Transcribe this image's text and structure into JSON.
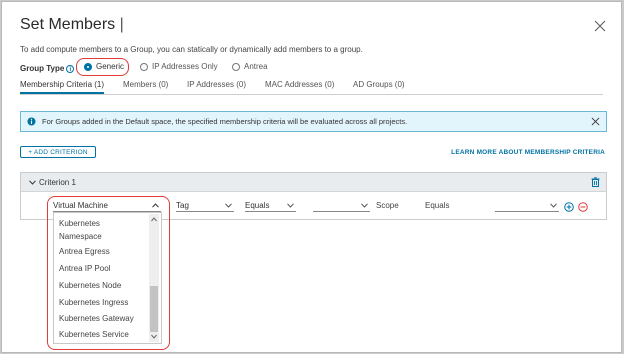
{
  "dialog": {
    "title": "Set Members",
    "title_cursor": "|",
    "description": "To add compute members to a Group, you can statically or dynamically add members to a group."
  },
  "group_type": {
    "label": "Group Type",
    "info_icon": "i",
    "options": [
      "Generic",
      "IP Addresses Only",
      "Antrea"
    ],
    "selected": "Generic"
  },
  "tabs": [
    {
      "label": "Membership Criteria (1)",
      "active": true
    },
    {
      "label": "Members (0)"
    },
    {
      "label": "IP Addresses (0)"
    },
    {
      "label": "MAC Addresses (0)"
    },
    {
      "label": "AD Groups (0)"
    }
  ],
  "alert": {
    "text": "For Groups added in the Default space, the specified membership criteria will be evaluated across all projects.",
    "icon": "info-circle-icon"
  },
  "actions": {
    "add_criterion": "+ ADD CRITERION",
    "learn_more": "LEARN MORE ABOUT MEMBERSHIP CRITERIA"
  },
  "criterion": {
    "title": "Criterion 1",
    "member_type": "Virtual Machine",
    "attribute": "Tag",
    "operator": "Equals",
    "value": "",
    "scope_label": "Scope",
    "scope_operator": "Equals",
    "scope_value": ""
  },
  "dropdown": {
    "items": [
      "Kubernetes",
      "Namespace",
      "Antrea Egress",
      "Antrea IP Pool",
      "Kubernetes Node",
      "Kubernetes Ingress",
      "Kubernetes Gateway",
      "Kubernetes Service"
    ]
  },
  "colors": {
    "accent": "#0072a3",
    "highlight": "#e23a3a",
    "alert_bg": "#e3f5fc",
    "add_icon": "#0072a3",
    "remove_icon": "#e23a3a"
  }
}
